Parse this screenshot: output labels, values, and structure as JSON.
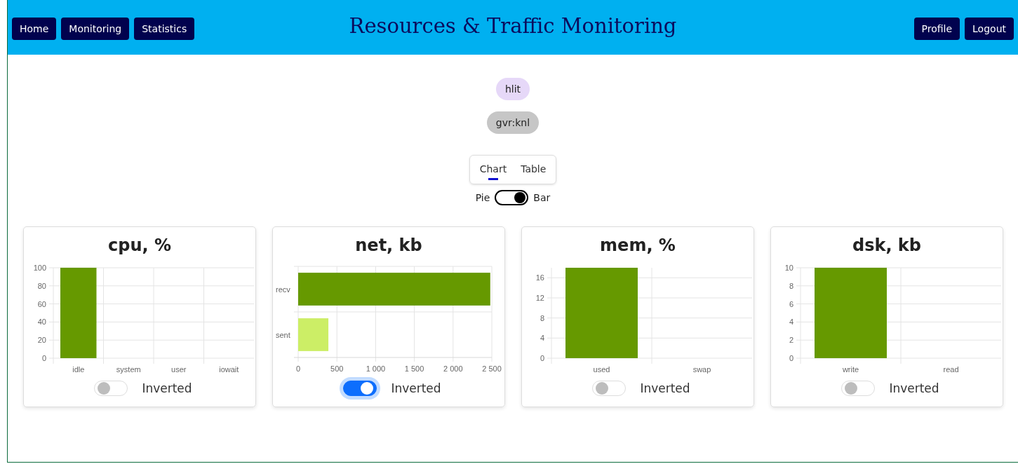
{
  "nav_left": [
    "Home",
    "Monitoring",
    "Statistics"
  ],
  "title": "Resources & Traffic Monitoring",
  "nav_right": [
    "Profile",
    "Logout"
  ],
  "pills": [
    {
      "label": "hlit",
      "color": "#e6d8f8"
    },
    {
      "label": "gvr:knl",
      "color": "#c6c6c6"
    }
  ],
  "tabs": [
    {
      "label": "Chart",
      "selected": true
    },
    {
      "label": "Table",
      "selected": false
    }
  ],
  "mode_switch": {
    "left": "Pie",
    "right": "Bar",
    "on": true
  },
  "cards": [
    {
      "title": "cpu, %",
      "inverted": false,
      "toggle_label": "Inverted",
      "chart_data": {
        "type": "bar",
        "orientation": "vertical",
        "grid": true,
        "categories": [
          "idle",
          "system",
          "user",
          "iowait"
        ],
        "colors": [
          "#669900",
          "#669900",
          "#669900",
          "#669900"
        ],
        "values": [
          100,
          0,
          0,
          0
        ],
        "ylim": [
          0,
          100
        ],
        "yticks": [
          0,
          20,
          40,
          60,
          80,
          100
        ]
      }
    },
    {
      "title": "net, kb",
      "inverted": true,
      "toggle_label": "Inverted",
      "chart_data": {
        "type": "bar",
        "orientation": "horizontal",
        "grid": true,
        "categories": [
          "recv",
          "sent"
        ],
        "colors": [
          "#669900",
          "#ccee66"
        ],
        "values": [
          2480,
          390
        ],
        "xlim": [
          0,
          2500
        ],
        "xticks": [
          0,
          {
            "value": 500,
            "label": "500"
          },
          {
            "value": 1000,
            "label": "1 000"
          },
          {
            "value": 1500,
            "label": "1 500"
          },
          {
            "value": 2000,
            "label": "2 000"
          },
          {
            "value": 2500,
            "label": "2 500"
          }
        ]
      }
    },
    {
      "title": "mem, %",
      "inverted": false,
      "toggle_label": "Inverted",
      "chart_data": {
        "type": "bar",
        "orientation": "vertical",
        "grid": true,
        "categories": [
          "used",
          "swap"
        ],
        "colors": [
          "#669900",
          "#669900"
        ],
        "values": [
          18,
          0
        ],
        "ylim": [
          0,
          18
        ],
        "yticks": [
          0,
          4,
          8,
          12,
          16
        ]
      }
    },
    {
      "title": "dsk, kb",
      "inverted": false,
      "toggle_label": "Inverted",
      "chart_data": {
        "type": "bar",
        "orientation": "vertical",
        "grid": true,
        "categories": [
          "write",
          "read"
        ],
        "colors": [
          "#669900",
          "#669900"
        ],
        "values": [
          10,
          0
        ],
        "ylim": [
          0,
          10
        ],
        "yticks": [
          0,
          2,
          4,
          6,
          8,
          10
        ]
      }
    }
  ]
}
